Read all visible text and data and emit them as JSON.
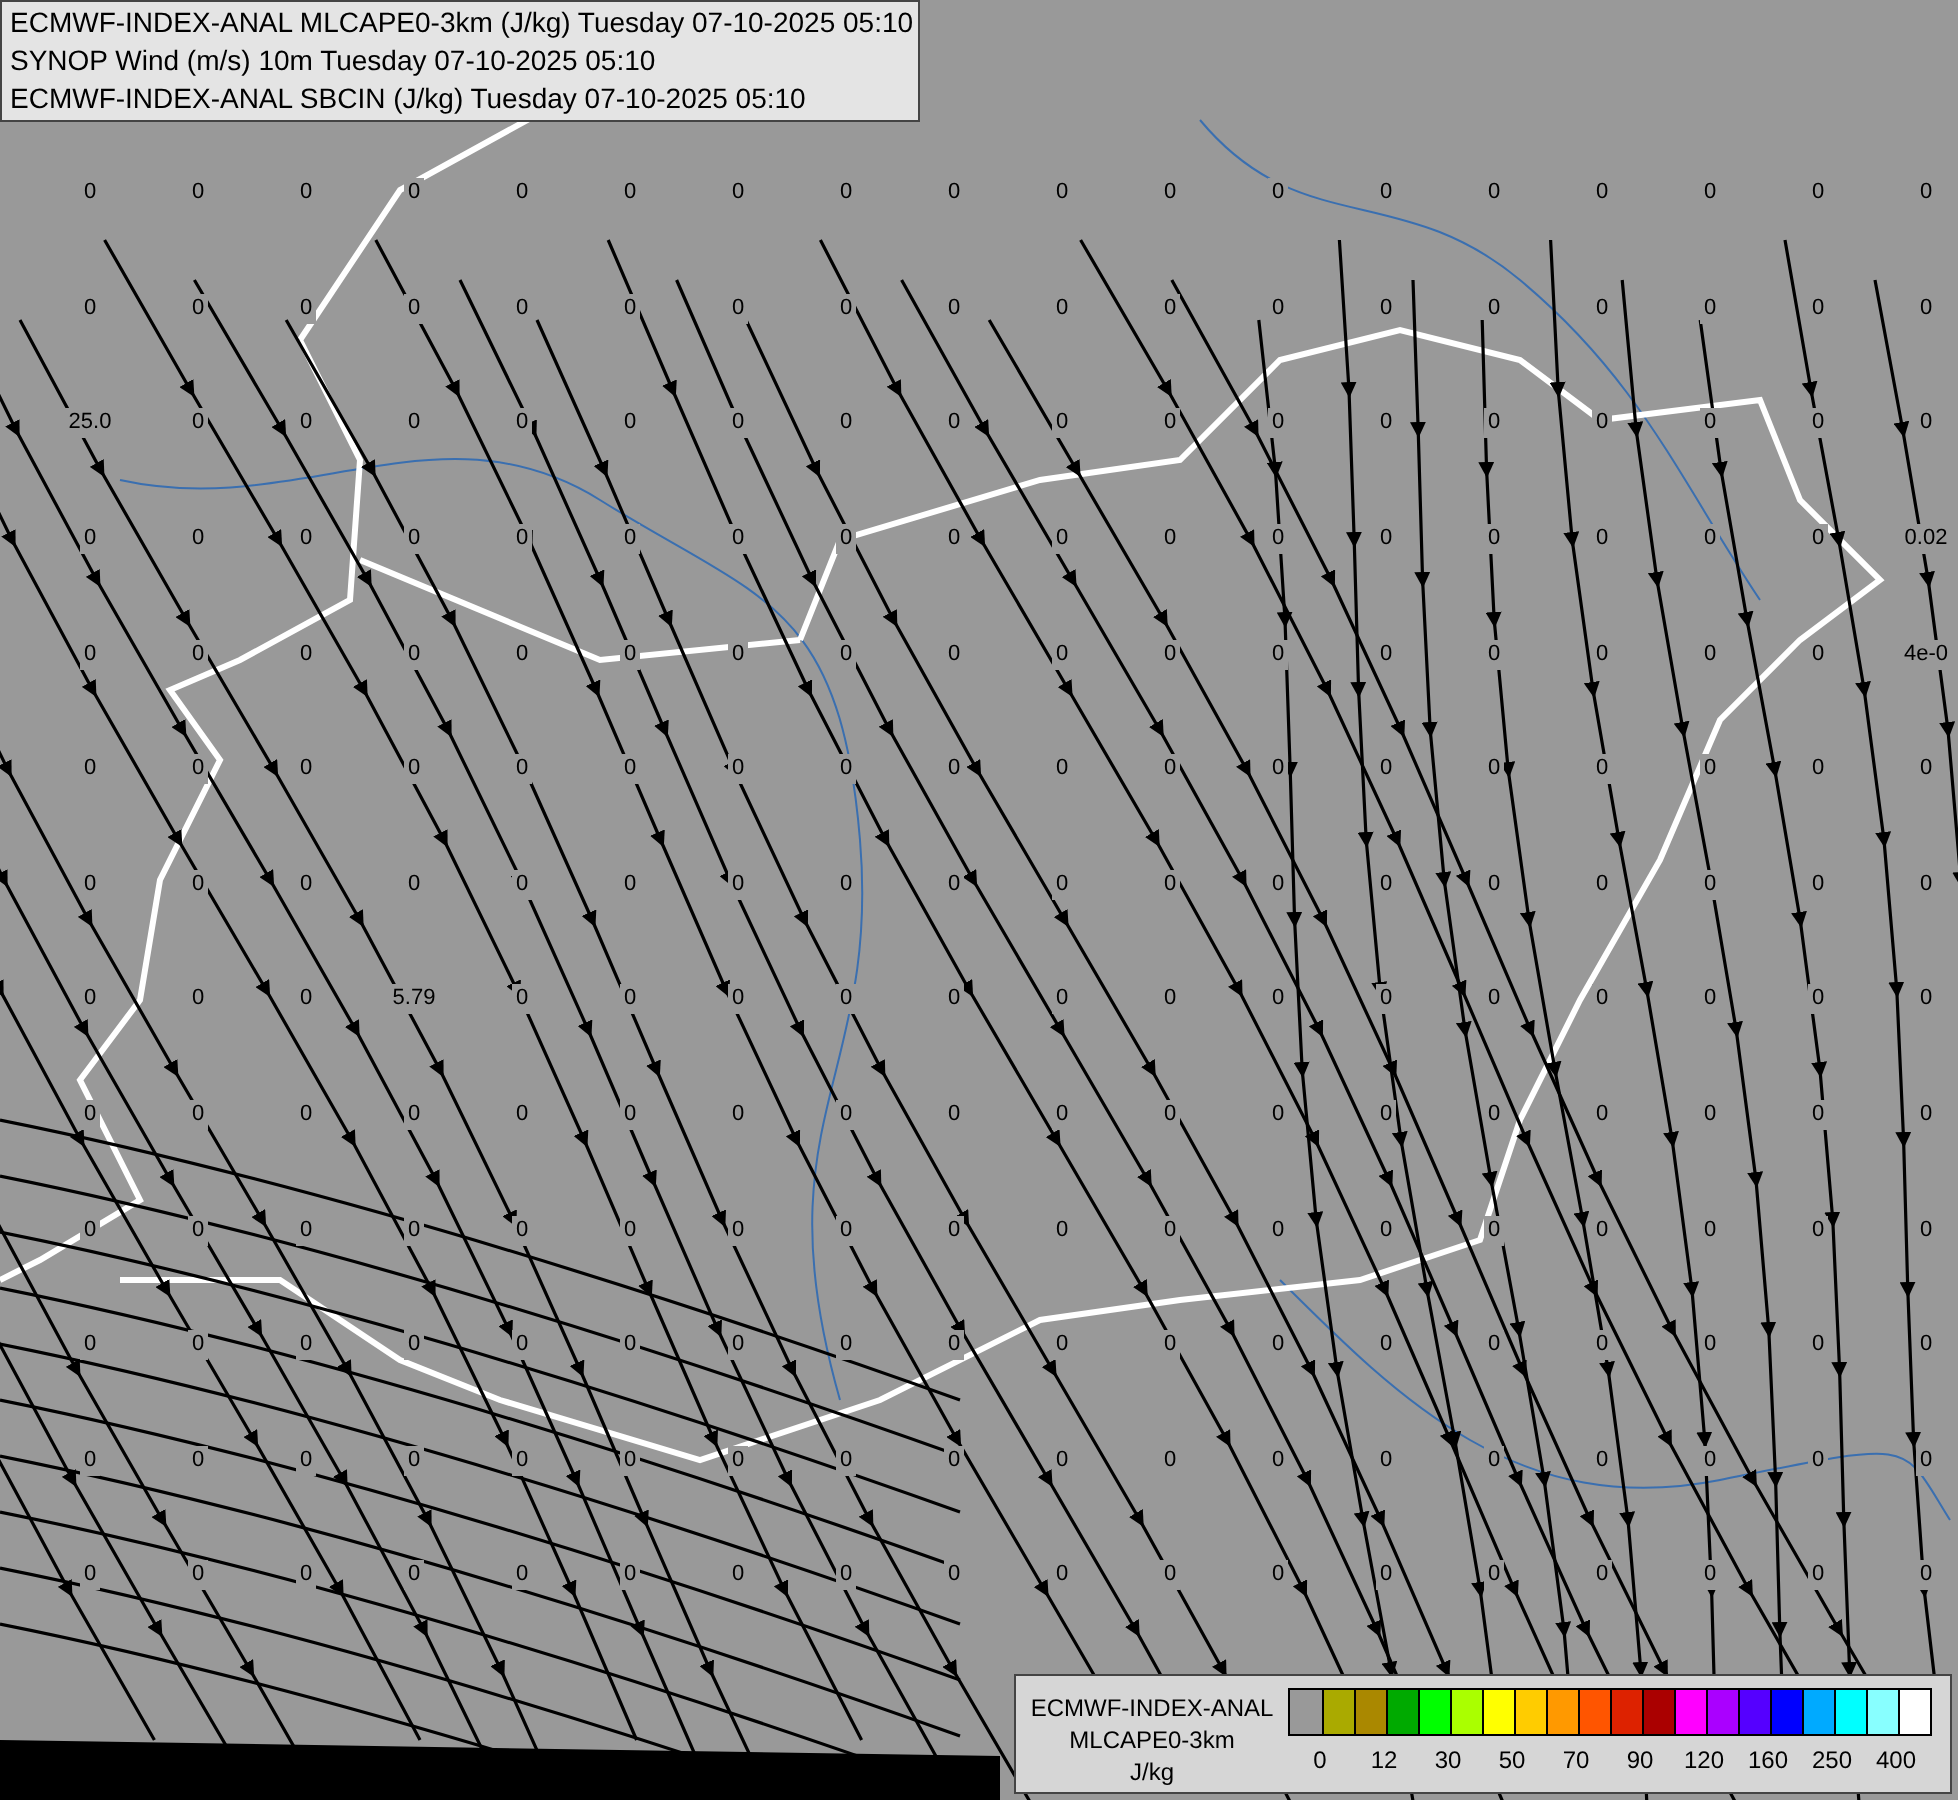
{
  "header": {
    "lines": [
      "ECMWF-INDEX-ANAL MLCAPE0-3km (J/kg) Tuesday 07-10-2025 05:10",
      "SYNOP Wind (m/s) 10m Tuesday 07-10-2025 05:10",
      "ECMWF-INDEX-ANAL SBCIN (J/kg) Tuesday 07-10-2025 05:10"
    ]
  },
  "map": {
    "value_rows": [
      [
        "0",
        "0",
        "0",
        "0",
        "0",
        "0",
        "0",
        "0",
        "0",
        "0",
        "0",
        "0",
        "0",
        "0",
        "0",
        "0",
        "0",
        "0"
      ],
      [
        "0",
        "0",
        "0",
        "0",
        "0",
        "0",
        "0",
        "0",
        "0",
        "0",
        "0",
        "0",
        "0",
        "0",
        "0",
        "0",
        "0",
        "0"
      ],
      [
        "25.0",
        "0",
        "0",
        "0",
        "0",
        "0",
        "0",
        "0",
        "0",
        "0",
        "0",
        "0",
        "0",
        "0",
        "0",
        "0",
        "0",
        "0"
      ],
      [
        "0",
        "0",
        "0",
        "0",
        "0",
        "0",
        "0",
        "0",
        "0",
        "0",
        "0",
        "0",
        "0",
        "0",
        "0",
        "0",
        "0",
        "0.02"
      ],
      [
        "0",
        "0",
        "0",
        "0",
        "0",
        "0",
        "0",
        "0",
        "0",
        "0",
        "0",
        "0",
        "0",
        "0",
        "0",
        "0",
        "0",
        "4e-0"
      ],
      [
        "0",
        "0",
        "0",
        "0",
        "0",
        "0",
        "0",
        "0",
        "0",
        "0",
        "0",
        "0",
        "0",
        "0",
        "0",
        "0",
        "0",
        "0"
      ],
      [
        "0",
        "0",
        "0",
        "0",
        "0",
        "0",
        "0",
        "0",
        "0",
        "0",
        "0",
        "0",
        "0",
        "0",
        "0",
        "0",
        "0",
        "0"
      ],
      [
        "0",
        "0",
        "0",
        "5.79",
        "0",
        "0",
        "0",
        "0",
        "0",
        "0",
        "0",
        "0",
        "0",
        "0",
        "0",
        "0",
        "0",
        "0"
      ],
      [
        "0",
        "0",
        "0",
        "0",
        "0",
        "0",
        "0",
        "0",
        "0",
        "0",
        "0",
        "0",
        "0",
        "0",
        "0",
        "0",
        "0",
        "0"
      ],
      [
        "0",
        "0",
        "0",
        "0",
        "0",
        "0",
        "0",
        "0",
        "0",
        "0",
        "0",
        "0",
        "0",
        "0",
        "0",
        "0",
        "0",
        "0"
      ],
      [
        "0",
        "0",
        "0",
        "0",
        "0",
        "0",
        "0",
        "0",
        "0",
        "0",
        "0",
        "0",
        "0",
        "0",
        "0",
        "0",
        "0",
        "0"
      ],
      [
        "0",
        "0",
        "0",
        "0",
        "0",
        "0",
        "0",
        "0",
        "0",
        "0",
        "0",
        "0",
        "0",
        "0",
        "0",
        "0",
        "0",
        "0"
      ],
      [
        "0",
        "0",
        "0",
        "0",
        "0",
        "0",
        "0",
        "0",
        "0",
        "0",
        "0",
        "0",
        "0",
        "0",
        "0",
        "0",
        "0",
        "0"
      ]
    ]
  },
  "legend": {
    "title_lines": [
      "ECMWF-INDEX-ANAL",
      "MLCAPE0-3km",
      "J/kg"
    ],
    "swatches": [
      {
        "color": "#999999"
      },
      {
        "color": "#aaaa00"
      },
      {
        "color": "#aa8800"
      },
      {
        "color": "#00aa00"
      },
      {
        "color": "#00ff00"
      },
      {
        "color": "#aaff00"
      },
      {
        "color": "#ffff00"
      },
      {
        "color": "#ffcc00"
      },
      {
        "color": "#ff9900"
      },
      {
        "color": "#ff5500"
      },
      {
        "color": "#dd2200"
      },
      {
        "color": "#aa0000"
      },
      {
        "color": "#ff00ff"
      },
      {
        "color": "#aa00ff"
      },
      {
        "color": "#5500ff"
      },
      {
        "color": "#0000ff"
      },
      {
        "color": "#00aaff"
      },
      {
        "color": "#00ffff"
      },
      {
        "color": "#88ffff"
      },
      {
        "color": "#ffffff"
      }
    ],
    "ticks": [
      "0",
      "12",
      "30",
      "50",
      "70",
      "90",
      "120",
      "160",
      "250",
      "400"
    ]
  }
}
